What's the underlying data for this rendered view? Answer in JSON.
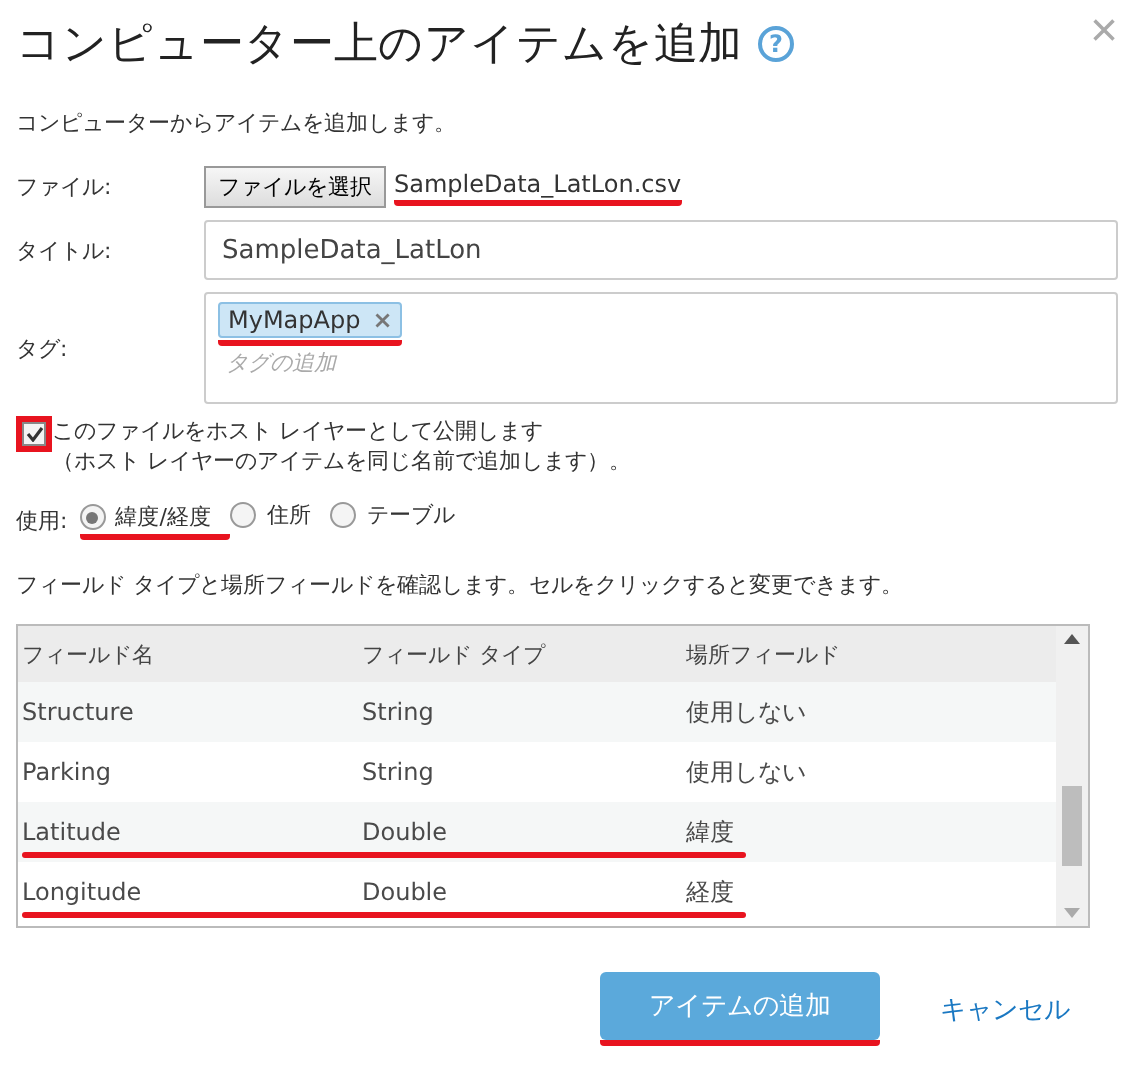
{
  "dialog": {
    "title": "コンピューター上のアイテムを追加",
    "help_icon": "?",
    "close": "×",
    "description": "コンピューターからアイテムを追加します。"
  },
  "file": {
    "label": "ファイル:",
    "button": "ファイルを選択",
    "filename": "SampleData_LatLon.csv",
    "highlighted": true
  },
  "title_field": {
    "label": "タイトル:",
    "value": "SampleData_LatLon"
  },
  "tags": {
    "label": "タグ:",
    "items": [
      {
        "text": "MyMapApp",
        "remove": "×",
        "highlighted": true
      }
    ],
    "placeholder": "タグの追加"
  },
  "publish": {
    "checked": true,
    "highlighted": true,
    "line_1": "このファイルをホスト レイヤーとして公開します",
    "line_2": "（ホスト レイヤーのアイテムを同じ名前で追加します）。"
  },
  "use": {
    "label": "使用:",
    "options": [
      {
        "text": "緯度/経度",
        "selected": true,
        "highlighted": true
      },
      {
        "text": "住所",
        "selected": false,
        "highlighted": false
      },
      {
        "text": "テーブル",
        "selected": false,
        "highlighted": false
      }
    ]
  },
  "hint": "フィールド タイプと場所フィールドを確認します。セルをクリックすると変更できます。",
  "table": {
    "columns": [
      "フィールド名",
      "フィールド タイプ",
      "場所フィールド"
    ],
    "rows": [
      {
        "cells": [
          "Structure",
          "String",
          "使用しない"
        ],
        "highlighted": false
      },
      {
        "cells": [
          "Parking",
          "String",
          "使用しない"
        ],
        "highlighted": false
      },
      {
        "cells": [
          "Latitude",
          "Double",
          "緯度"
        ],
        "highlighted": true
      },
      {
        "cells": [
          "Longitude",
          "Double",
          "経度"
        ],
        "highlighted": true
      }
    ]
  },
  "buttons": {
    "primary": {
      "text": "アイテムの追加",
      "highlighted": true
    },
    "cancel": "キャンセル"
  }
}
